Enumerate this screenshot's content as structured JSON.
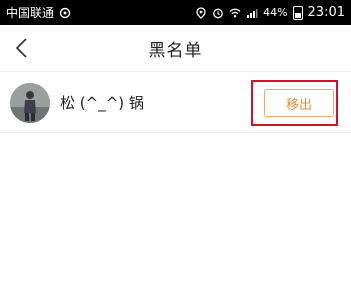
{
  "status_bar": {
    "carrier": "中国联通",
    "battery_percent": "44%",
    "time": "23:01",
    "network": "4G"
  },
  "nav": {
    "title": "黑名单"
  },
  "blacklist": {
    "items": [
      {
        "name": "松 (^_^) 锅",
        "action_label": "移出"
      }
    ]
  },
  "colors": {
    "accent": "#f08a3a",
    "highlight": "#d0122a"
  }
}
